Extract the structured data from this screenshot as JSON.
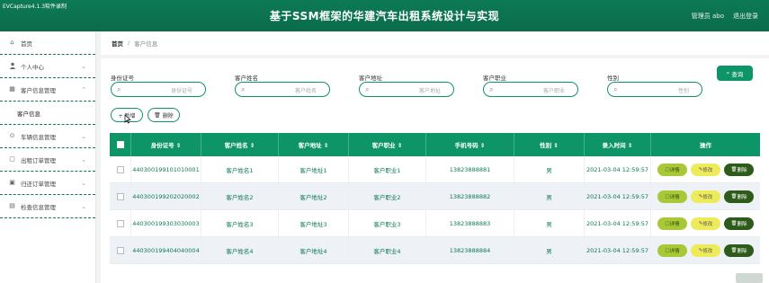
{
  "app": {
    "window_label": "EVCapture4.1.3软件录制",
    "title": "基于SSM框架的华建汽车出租系统设计与实现",
    "user_text": "管理员 abo",
    "logout": "退出登录"
  },
  "sidebar": {
    "items": [
      {
        "label": "首页",
        "icon": "⌂"
      },
      {
        "label": "个人中心",
        "icon": "👤"
      },
      {
        "label": "客户信息管理",
        "icon": "▦"
      },
      {
        "label": "车辆信息管理",
        "icon": "⊙"
      },
      {
        "label": "出租订单管理",
        "icon": "▢"
      },
      {
        "label": "归还订单管理",
        "icon": "▣"
      },
      {
        "label": "检查信息管理",
        "icon": "▤"
      }
    ],
    "active_sub": "客户信息"
  },
  "breadcrumb": {
    "home": "首页",
    "separator": "/",
    "current": "客户信息"
  },
  "filters": [
    {
      "label": "身份证号",
      "placeholder": "身份证号"
    },
    {
      "label": "客户姓名",
      "placeholder": "客户姓名"
    },
    {
      "label": "客户地址",
      "placeholder": "客户地址"
    },
    {
      "label": "客户职业",
      "placeholder": "客户职业"
    },
    {
      "label": "性别",
      "placeholder": "性别"
    }
  ],
  "actions": {
    "query": "查询",
    "add": "+ 新增",
    "delete": "删除"
  },
  "table": {
    "headers": [
      "身份证号 ⇕",
      "客户姓名 ⇕",
      "客户地址 ⇕",
      "客户职业 ⇕",
      "手机号码 ⇕",
      "性别 ⇕",
      "录入时间 ⇕",
      "操作"
    ],
    "op_labels": {
      "detail": "详情",
      "edit": "修改",
      "delete": "删除"
    },
    "rows": [
      {
        "id": "440300199101010001",
        "name": "客户姓名1",
        "addr": "客户地址1",
        "job": "客户职业1",
        "phone": "13823888881",
        "sex": "男",
        "time": "2021-03-04 12:59:57"
      },
      {
        "id": "440300199202020002",
        "name": "客户姓名2",
        "addr": "客户地址2",
        "job": "客户职业2",
        "phone": "13823888882",
        "sex": "男",
        "time": "2021-03-04 12:59:57"
      },
      {
        "id": "440300199303030003",
        "name": "客户姓名3",
        "addr": "客户地址3",
        "job": "客户职业3",
        "phone": "13823888883",
        "sex": "男",
        "time": "2021-03-04 12:59:57"
      },
      {
        "id": "440300199404040004",
        "name": "客户姓名4",
        "addr": "客户地址4",
        "job": "客户职业4",
        "phone": "13823888884",
        "sex": "男",
        "time": "2021-03-04 12:59:57"
      }
    ]
  },
  "colors": {
    "primary": "#0d9467",
    "header": "#0d7a55",
    "detail_btn": "#a8c838",
    "edit_btn": "#eeeb5a",
    "delete_btn": "#2d5c1a"
  }
}
